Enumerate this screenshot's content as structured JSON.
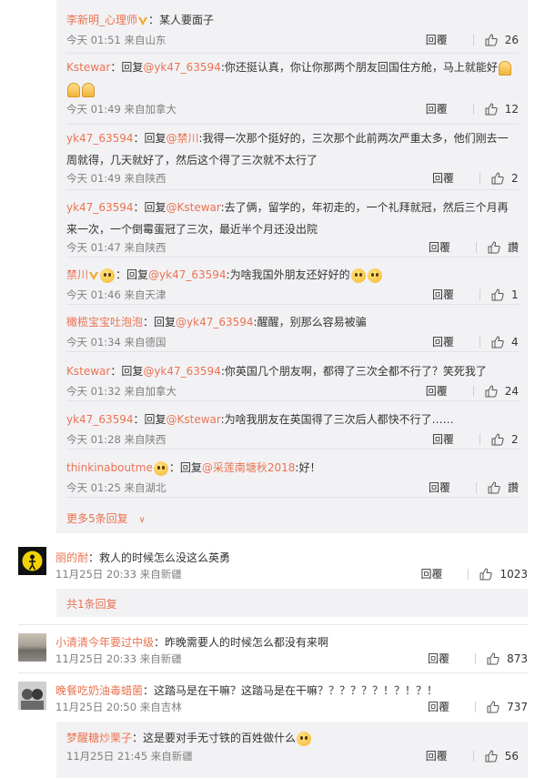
{
  "thread_replies": [
    {
      "user": "李新明_心理师",
      "badge": "v",
      "reply_to": "",
      "mention": "",
      "text": "：某人要面子",
      "emojis_after": [],
      "time": "今天 01:51 来自山东",
      "reply_label": "回覆",
      "likes": "26"
    },
    {
      "user": "Kstewar",
      "badge": "",
      "reply_to": "：回复",
      "mention": "@yk47_63594",
      "text": ":你还挺认真，你让你那两个朋友回国住方舱，马上就能好",
      "emojis_after": [
        "thumbup",
        "thumbup",
        "thumbup"
      ],
      "time": "今天 01:49 来自加拿大",
      "reply_label": "回覆",
      "likes": "12"
    },
    {
      "user": "yk47_63594",
      "badge": "",
      "reply_to": "：回复",
      "mention": "@禁川",
      "text": ":我得一次那个挺好的，三次那个此前两次严重太多，他们刚去一周就得，几天就好了，然后这个得了三次就不太行了",
      "emojis_after": [],
      "time": "今天 01:49 来自陕西",
      "reply_label": "回覆",
      "likes": "2"
    },
    {
      "user": "yk47_63594",
      "badge": "",
      "reply_to": "：回复",
      "mention": "@Kstewar",
      "text": ":去了俩，留学的，年初走的，一个礼拜就冠，然后三个月再来一次，一个倒霉蛋冠了三次，最近半个月还没出院",
      "emojis_after": [],
      "time": "今天 01:47 来自陕西",
      "reply_label": "回覆",
      "likes": "讚"
    },
    {
      "user": "禁川",
      "badge": "v",
      "reply_to": "：回复",
      "mention": "@yk47_63594",
      "text": ":为啥我国外朋友还好好的",
      "emojis_after": [
        "face",
        "face"
      ],
      "time": "今天 01:46 来自天津",
      "reply_label": "回覆",
      "likes": "1"
    },
    {
      "user": "橄榄宝宝吐泡泡",
      "badge": "",
      "reply_to": "：回复",
      "mention": "@yk47_63594",
      "text": ":醒醒，别那么容易被骗",
      "emojis_after": [],
      "time": "今天 01:34 来自德国",
      "reply_label": "回覆",
      "likes": "4"
    },
    {
      "user": "Kstewar",
      "badge": "",
      "reply_to": "：回复",
      "mention": "@yk47_63594",
      "text": ":你英国几个朋友啊，都得了三次全都不行了？笑死我了",
      "emojis_after": [],
      "time": "今天 01:32 来自加拿大",
      "reply_label": "回覆",
      "likes": "24"
    },
    {
      "user": "yk47_63594",
      "badge": "",
      "reply_to": "：回复",
      "mention": "@Kstewar",
      "text": ":为啥我朋友在英国得了三次后人都快不行了……",
      "emojis_after": [],
      "time": "今天 01:28 来自陕西",
      "reply_label": "回覆",
      "likes": "2"
    },
    {
      "user": "thinkinaboutme",
      "badge": "face",
      "reply_to": "：回复",
      "mention": "@采莲南塘秋2018",
      "text": ":好！",
      "emojis_after": [],
      "time": "今天 01:25 来自湖北",
      "reply_label": "回覆",
      "likes": "讚"
    }
  ],
  "more_replies": "更多5条回复",
  "comments": [
    {
      "user": "丽的耐",
      "text": "：救人的时候怎么没这么英勇",
      "time": "11月25日 20:33 来自新疆",
      "reply_label": "回覆",
      "likes": "1023",
      "sub": "共1条回复"
    },
    {
      "user": "小清清今年要过中级",
      "text": "：昨晚需要人的时候怎么都没有来啊",
      "time": "11月25日 20:33 来自新疆",
      "reply_label": "回覆",
      "likes": "873"
    },
    {
      "user": "晚餐吃奶油毒蜡菌",
      "text": "：这踏马是在干嘛？这踏马是在干嘛？？？？？？！？！？！",
      "time": "11月25日 20:50 来自吉林",
      "reply_label": "回覆",
      "likes": "737"
    }
  ],
  "last_reply": {
    "user": "梦醒糖炒栗子",
    "text": "：这是要对手无寸铁的百姓做什么",
    "time": "11月25日 21:45 来自新疆",
    "reply_label": "回覆",
    "likes": "56"
  },
  "colors": {
    "link": "#eb7350",
    "panel": "#f2f2f5",
    "meta": "#808080"
  }
}
